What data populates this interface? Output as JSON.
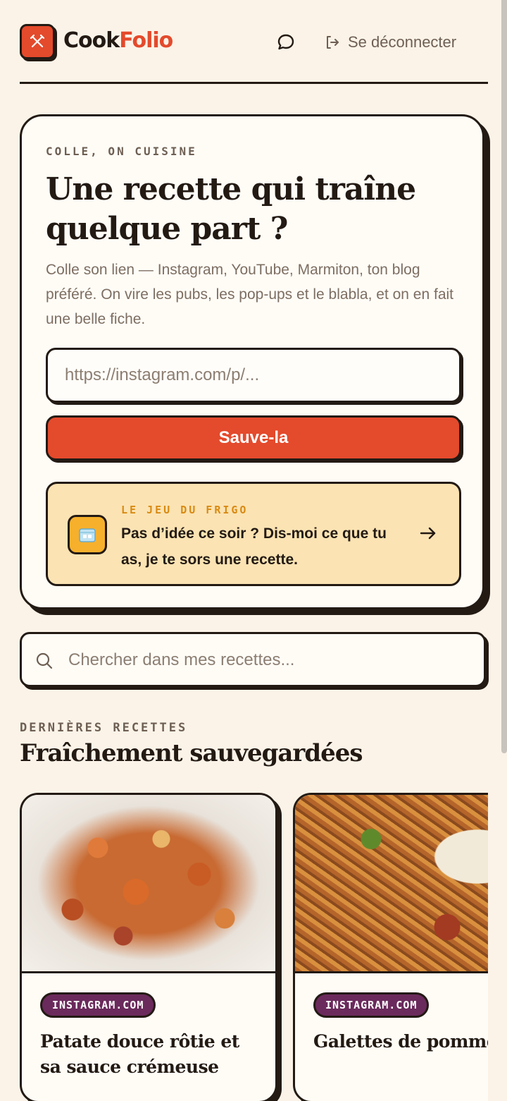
{
  "header": {
    "brand_part1": "Cook",
    "brand_part2": "Folio",
    "logout_label": "Se déconnecter",
    "logo_icon": "fork-knife-icon",
    "chat_icon": "chat-bubble-icon",
    "logout_icon": "logout-icon"
  },
  "hero": {
    "eyebrow": "COLLE, ON CUISINE",
    "title": "Une recette qui traîne quelque part ?",
    "description": "Colle son lien — Instagram, YouTube, Marmiton, ton blog préféré. On vire les pubs, les pop-ups et le blabla, et on en fait une belle fiche.",
    "url_placeholder": "https://instagram.com/p/...",
    "save_label": "Sauve-la"
  },
  "frigo": {
    "eyebrow": "LE JEU DU FRIGO",
    "text": "Pas d’idée ce soir ? Dis-moi ce que tu as, je te sors une recette.",
    "icon": "ice-cube-icon",
    "arrow_icon": "arrow-right-icon"
  },
  "search": {
    "placeholder": "Chercher dans mes recettes..."
  },
  "recent": {
    "eyebrow": "DERNIÈRES RECETTES",
    "title": "Fraîchement sauvegardées",
    "recipes": [
      {
        "source": "INSTAGRAM.COM",
        "title": "Patate douce rôtie et sa sauce crémeuse"
      },
      {
        "source": "INSTAGRAM.COM",
        "title": "Galettes de pommes de terre à la burrata"
      }
    ]
  },
  "colors": {
    "background": "#fbf3e8",
    "accent": "#e44a2c",
    "ink": "#231a14",
    "frigo_bg": "#fbe3b3",
    "badge": "#6b2a5c"
  }
}
